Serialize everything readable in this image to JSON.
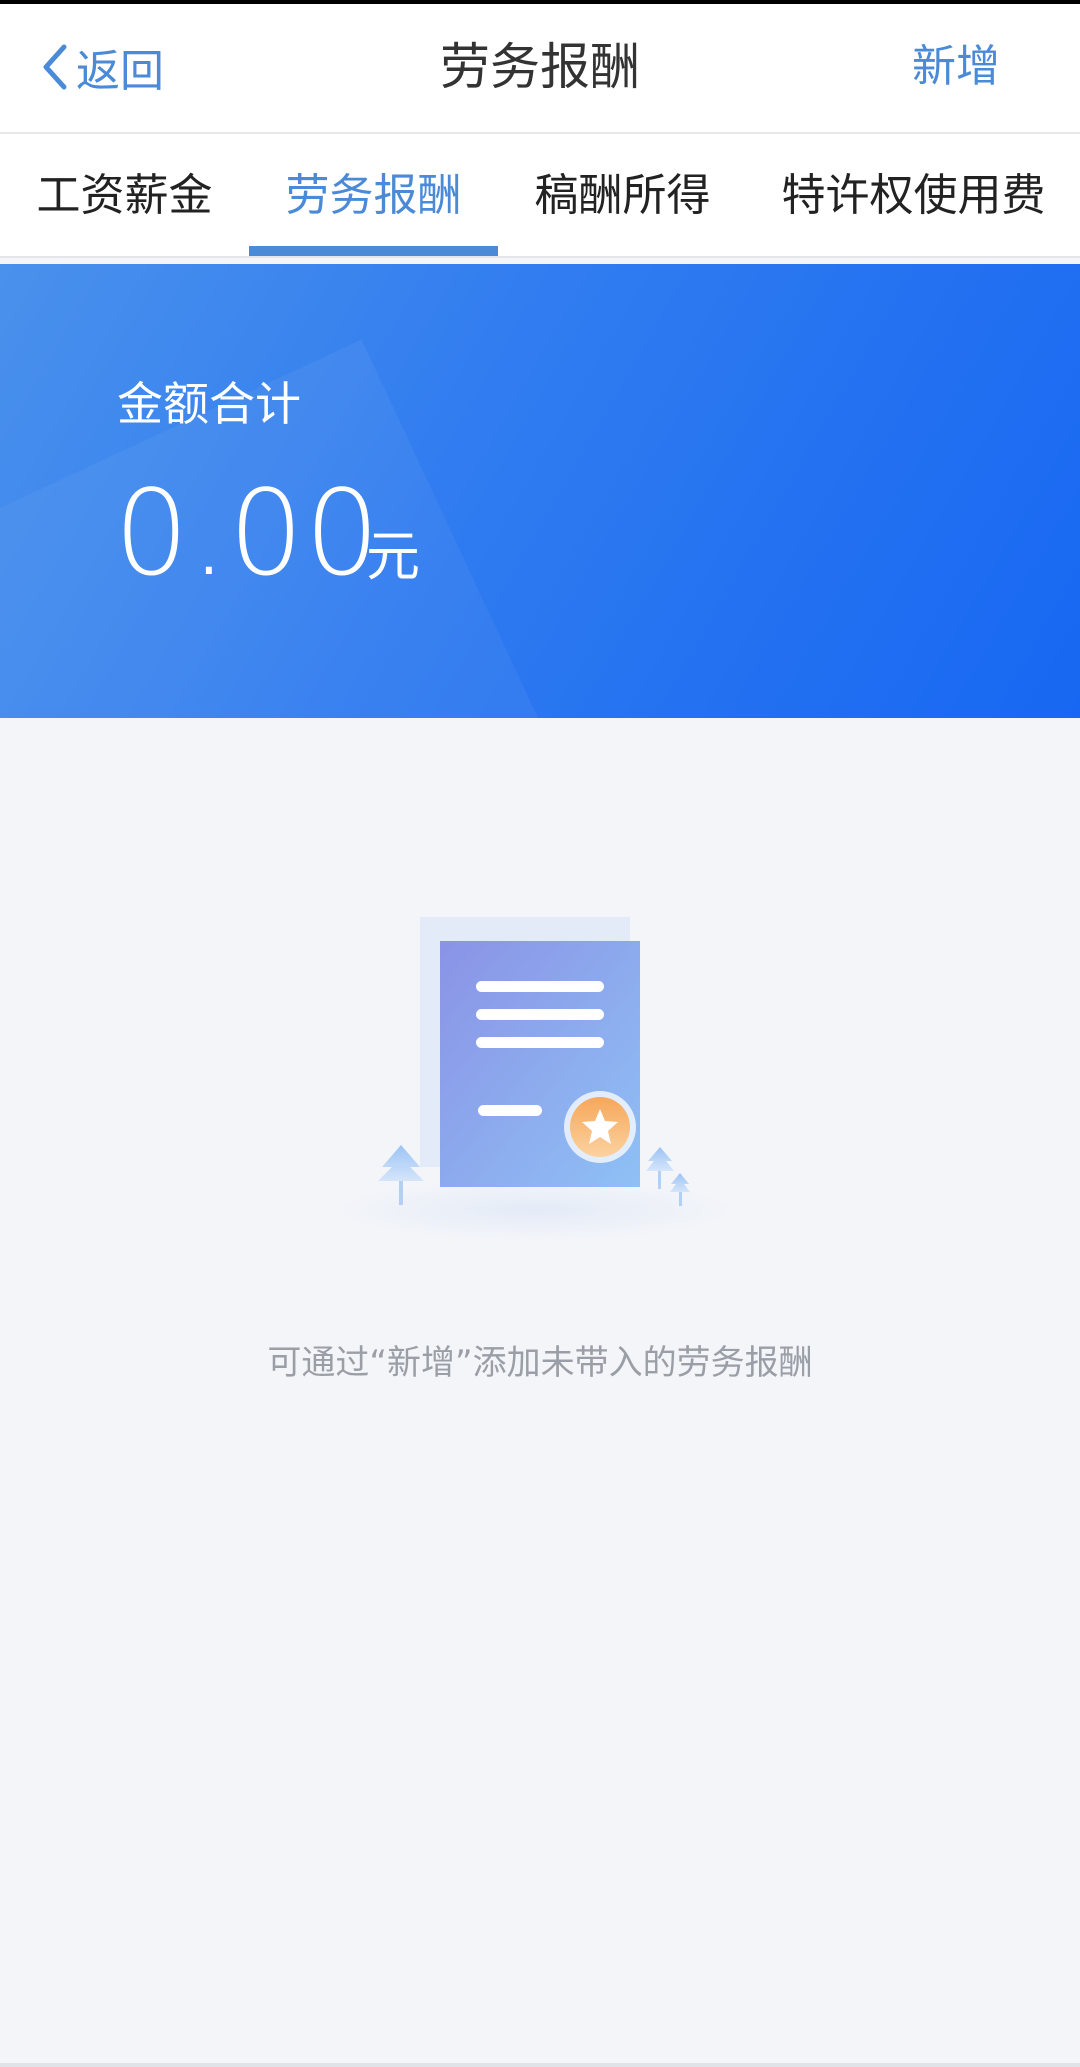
{
  "navbar": {
    "back_label": "返回",
    "title": "劳务报酬",
    "add_label": "新增"
  },
  "tabs": [
    {
      "label": "工资薪金",
      "active": false
    },
    {
      "label": "劳务报酬",
      "active": true
    },
    {
      "label": "稿酬所得",
      "active": false
    },
    {
      "label": "特许权使用费",
      "active": false
    }
  ],
  "summary": {
    "label": "金额合计",
    "amount": "0.00",
    "unit": "元"
  },
  "empty_state": {
    "message": "可通过“新增”添加未带入的劳务报酬",
    "icon": "document-star-icon"
  },
  "colors": {
    "accent": "#4a8ad6",
    "hero_gradient_start": "#4a91ec",
    "hero_gradient_end": "#1767f2",
    "page_background": "#f3f5f9"
  }
}
